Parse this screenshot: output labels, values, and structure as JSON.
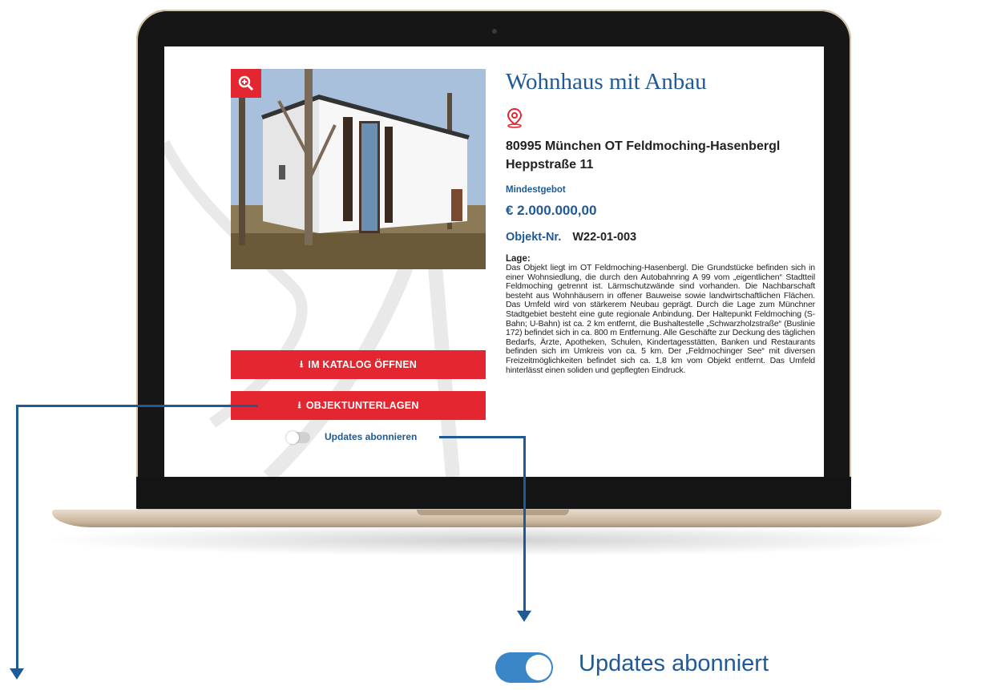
{
  "listing": {
    "title": "Wohnhaus mit Anbau",
    "address_line1": "80995 München OT Feldmoching-Hasenbergl",
    "address_line2": "Heppstraße 11",
    "min_bid_label": "Mindestgebot",
    "min_bid_value": "€ 2.000.000,00",
    "object_nr_label": "Objekt-Nr.",
    "object_nr_value": "W22-01-003",
    "location_heading": "Lage:",
    "location_text": "Das Objekt liegt im OT Feldmoching-Hasenbergl. Die Grundstücke befinden sich in einer Wohnsiedlung, die durch den Autobahnring A 99 vom „eigentlichen“ Stadtteil Feldmoching getrennt ist. Lärmschutzwände sind vorhanden. Die Nachbarschaft besteht aus Wohnhäusern in offener Bauweise sowie landwirtschaftlichen Flächen. Das Umfeld wird von stärkerem Neubau geprägt. Durch die Lage zum Münchner Stadtgebiet besteht eine gute regionale Anbindung. Der Haltepunkt Feldmoching (S-Bahn; U-Bahn) ist ca. 2 km entfernt, die Bushaltestelle „Schwarzholzstraße“ (Buslinie 172) befindet sich in ca. 800 m Entfernung. Alle Geschäfte zur Deckung des täglichen Bedarfs, Ärzte, Apotheken, Schulen, Kindertagesstätten, Banken und Restaurants befinden sich im Umkreis von ca. 5 km. Der „Feldmochinger See“ mit diversen Freizeitmöglichkeiten befindet sich ca. 1,8 km vom Objekt entfernt. Das Umfeld hinterlässt einen soliden und gepflegten Eindruck."
  },
  "actions": {
    "catalog_button": "IM KATALOG ÖFFNEN",
    "documents_button": "OBJEKTUNTERLAGEN",
    "subscribe_toggle_label": "Updates abonnieren"
  },
  "callout": {
    "subscribed_label": "Updates abonniert"
  },
  "icons": {
    "zoom": "zoom-in-icon",
    "location": "map-pin-icon",
    "download": "download-icon"
  },
  "colors": {
    "accent_red": "#e3262f",
    "brand_blue": "#1f5a96",
    "toggle_on": "#3a86c8",
    "toggle_off": "#d0d0d0"
  },
  "toggles": {
    "screen_subscribe_on": false,
    "callout_subscribe_on": true
  }
}
